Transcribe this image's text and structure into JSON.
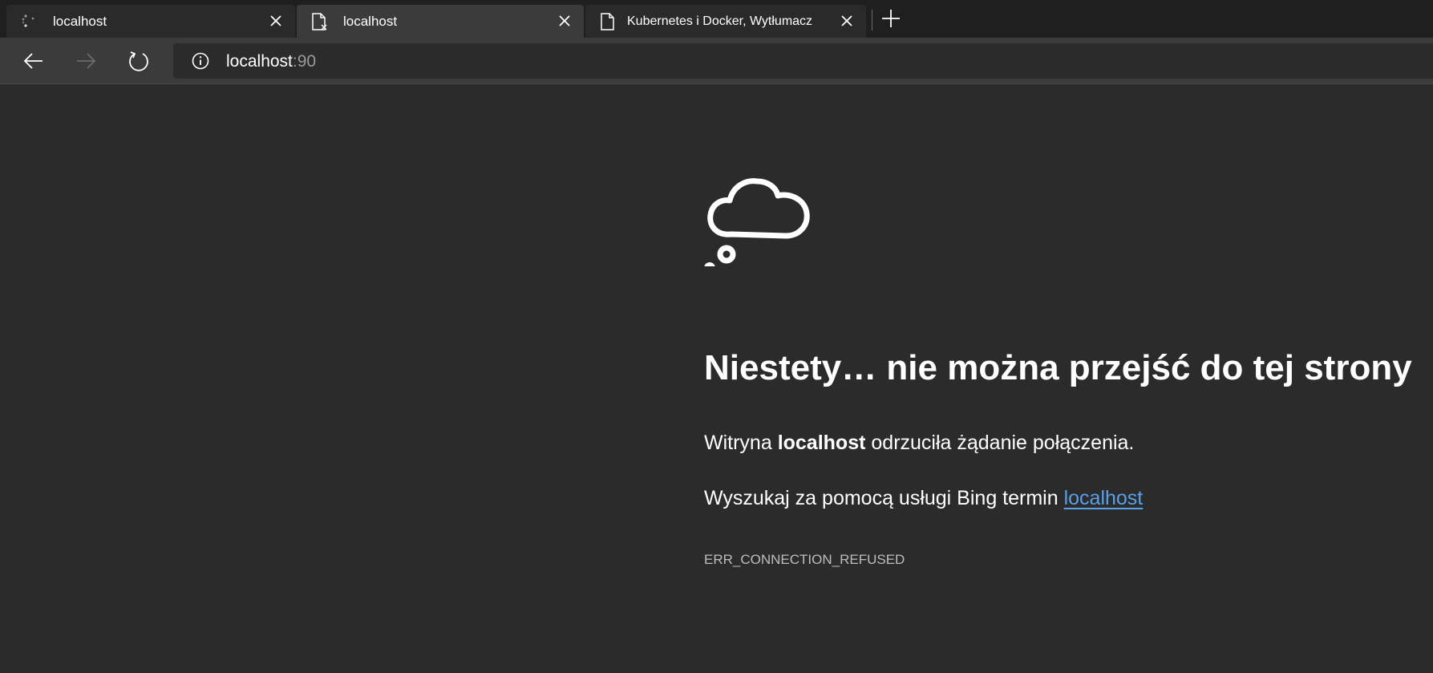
{
  "tabs": [
    {
      "label": "localhost",
      "icon": "loading-spinner-icon",
      "active": false
    },
    {
      "label": "localhost",
      "icon": "page-error-icon",
      "active": true
    },
    {
      "label": "Kubernetes i Docker, Wytłumacz",
      "icon": "page-icon",
      "active": false
    }
  ],
  "address_bar": {
    "host": "localhost",
    "port": ":90"
  },
  "error_page": {
    "title": "Niestety… nie można przejść do tej strony",
    "line1_prefix": "Witryna ",
    "line1_host": "localhost",
    "line1_suffix": " odrzuciła żądanie połączenia.",
    "line2_prefix": "Wyszukaj za pomocą usługi Bing termin ",
    "line2_link": "localhost",
    "error_code": "ERR_CONNECTION_REFUSED"
  },
  "colors": {
    "background": "#2b2b2b",
    "link": "#5aa0e8"
  }
}
